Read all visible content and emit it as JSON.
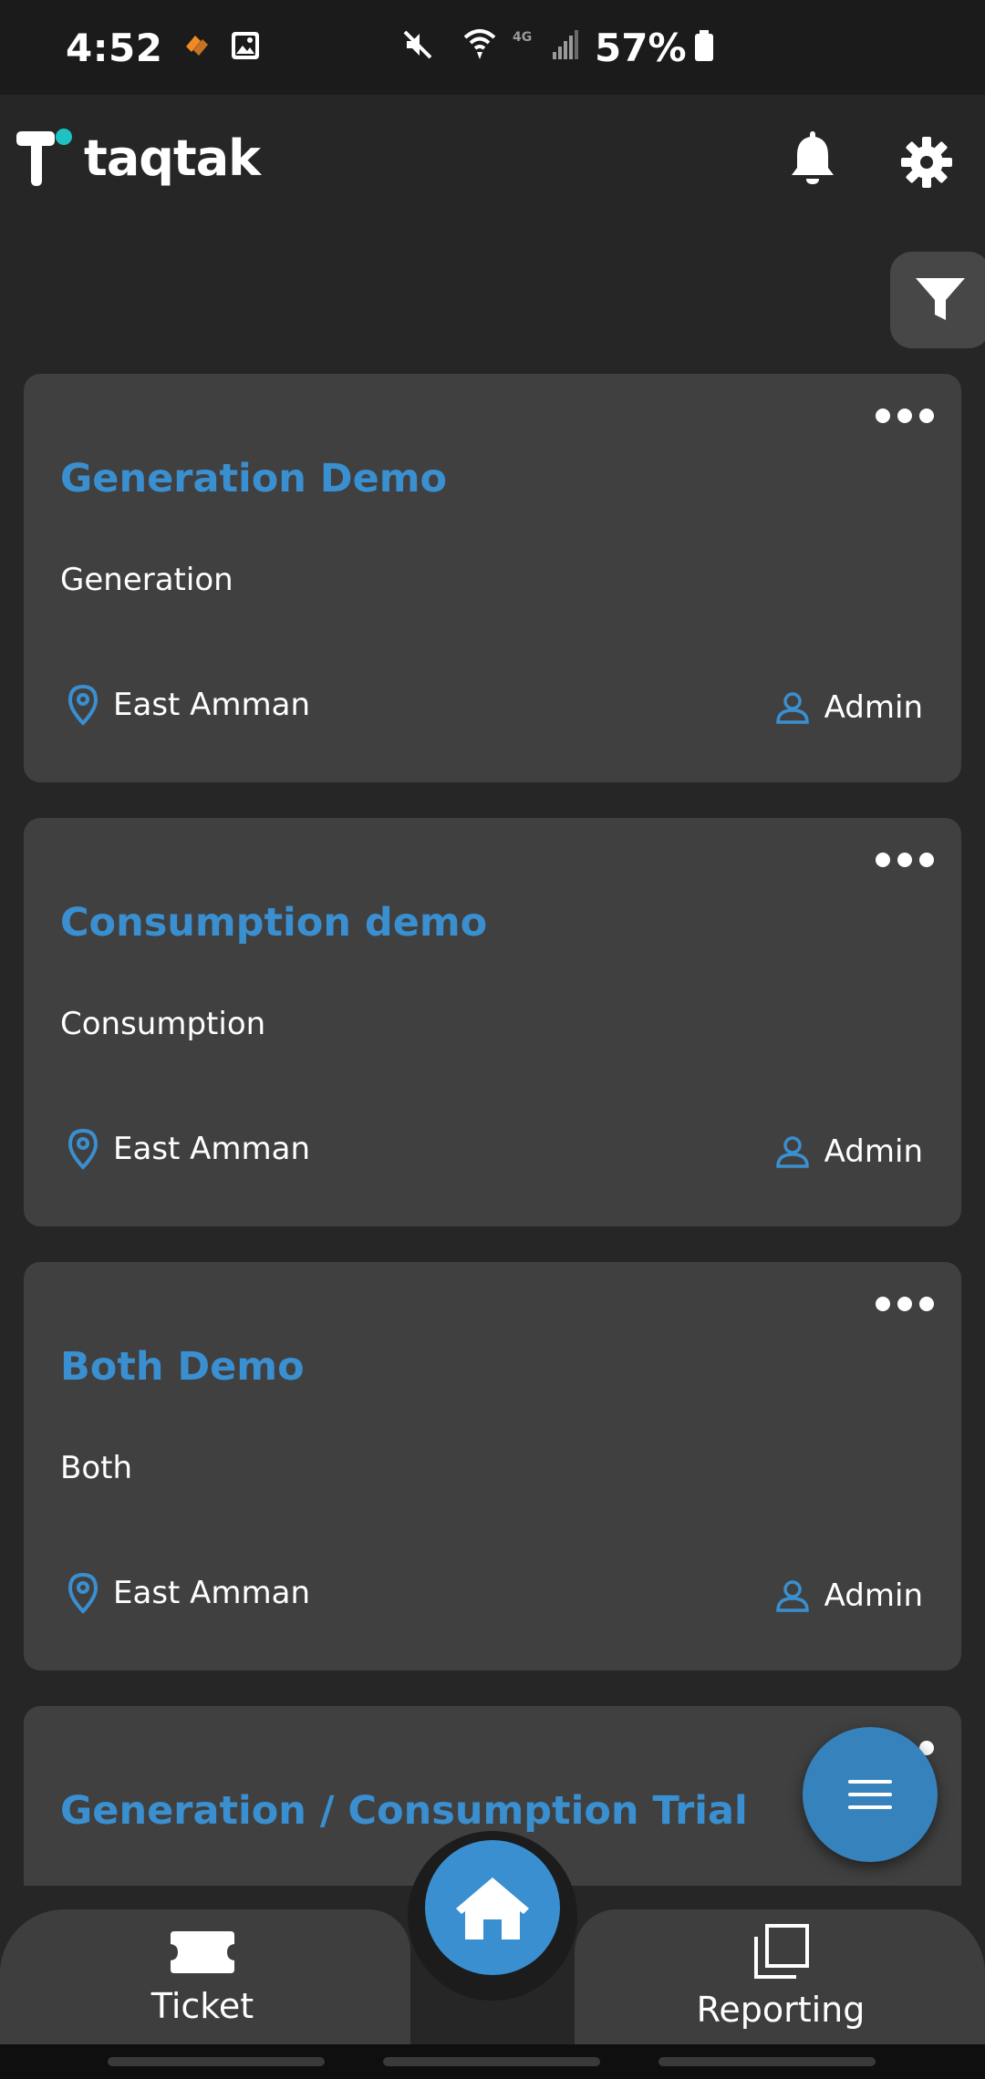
{
  "status_bar": {
    "time": "4:52",
    "battery": "57%",
    "icons": [
      "notification-icon",
      "image-icon",
      "mute-icon",
      "wifi-icon",
      "signal-icon",
      "battery-icon"
    ]
  },
  "header": {
    "logo_text": "taqtak",
    "icons": [
      "bell-icon",
      "gear-icon"
    ]
  },
  "filter": {
    "icon": "filter-icon"
  },
  "cards": [
    {
      "title": "Generation Demo",
      "type": "Generation",
      "location": "East Amman",
      "user": "Admin"
    },
    {
      "title": "Consumption demo",
      "type": "Consumption",
      "location": "East Amman",
      "user": "Admin"
    },
    {
      "title": "Both Demo",
      "type": "Both",
      "location": "East Amman",
      "user": "Admin"
    },
    {
      "title": "Generation / Consumption Trial"
    }
  ],
  "bottom_nav": {
    "ticket_label": "Ticket",
    "reporting_label": "Reporting",
    "home_icon": "home-icon"
  },
  "colors": {
    "accent": "#3a8fd0",
    "card_bg": "#404040",
    "background": "#262626",
    "status_bar_bg": "#1b1b1b"
  }
}
